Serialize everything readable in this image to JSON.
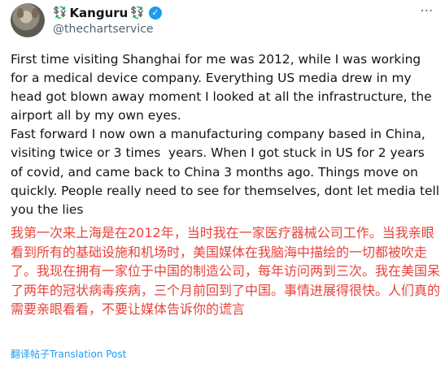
{
  "author": {
    "display_name": "Kanguru",
    "handle": "@thechartservice",
    "name_glyph_left": "💱",
    "name_glyph_right": "💱"
  },
  "post": {
    "text_en": "First time visiting Shanghai for me was 2012, while I was working for a medical device company. Everything US media drew in my head got blown away moment I looked at all the infrastructure, the airport all by my own eyes.\nFast forward I now own a manufacturing company based in China, visiting twice or 3 times  years. When I got stuck in US for 2 years of covid, and came back to China 3 months ago. Things move on quickly. People really need to see for themselves, dont let media tell you the lies",
    "text_zh": "我第一次来上海是在2012年，当时我在一家医疗器械公司工作。当我亲眼看到所有的基础设施和机场时，美国媒体在我脑海中描绘的一切都被吹走了。我现在拥有一家位于中国的制造公司，每年访问两到三次。我在美国呆了两年的冠状病毒疾病，三个月前回到了中国。事情进展得很快。人们真的需要亲眼看看，不要让媒体告诉你的谎言"
  },
  "actions": {
    "translate_label": "翻译帖子Translation Post",
    "more_icon": "⋯"
  },
  "colors": {
    "verified": "#1d9bf0",
    "translation_text": "#e8423a",
    "link": "#1d9bf0"
  },
  "icons": [
    "avatar",
    "verified-badge-icon",
    "more-options-icon"
  ]
}
